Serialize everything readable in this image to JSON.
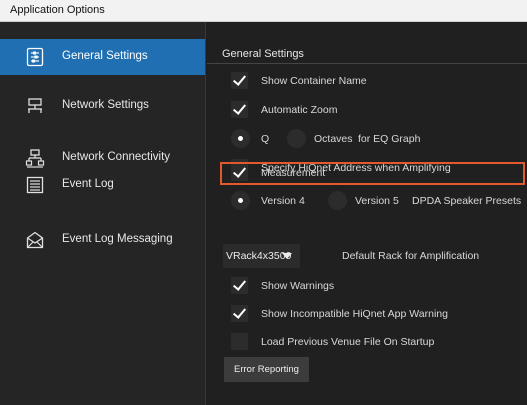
{
  "window": {
    "title": "Application Options"
  },
  "sidebar": {
    "items": [
      {
        "label": "General Settings",
        "icon": "settings-panel-icon",
        "active": true
      },
      {
        "label": "Network Settings",
        "icon": "network-icon",
        "active": false
      },
      {
        "label": "Network Connectivity",
        "icon": "network-tree-icon",
        "active": false
      },
      {
        "label": "Event Log",
        "icon": "list-icon",
        "active": false
      },
      {
        "label": "Event Log Messaging",
        "icon": "envelope-icon",
        "active": false
      }
    ]
  },
  "main": {
    "section_title": "General Settings",
    "show_container_name": {
      "label": "Show Container Name",
      "checked": true
    },
    "automatic_zoom": {
      "label": "Automatic Zoom",
      "checked": true
    },
    "eq_graph": {
      "option_q": "Q",
      "option_octaves": "Octaves",
      "suffix": "for EQ Graph",
      "selected": "Q"
    },
    "hiqnet_address": {
      "label": "Specify HiQnet Address when Amplifying",
      "checked": false
    },
    "measurement": {
      "label": "Measurement",
      "checked": true
    },
    "speaker_presets": {
      "option_v4": "Version 4",
      "option_v5": "Version 5",
      "suffix": "DPDA Speaker Presets",
      "selected": "Version 4"
    },
    "default_rack": {
      "value": "VRack4x3500",
      "label": "Default Rack for Amplification"
    },
    "show_warnings": {
      "label": "Show Warnings",
      "checked": true
    },
    "incompatible_warning": {
      "label": "Show Incompatible HiQnet App Warning",
      "checked": true
    },
    "load_previous_venue": {
      "label": "Load Previous Venue File On Startup",
      "checked": false
    },
    "error_reporting_button": "Error Reporting"
  },
  "colors": {
    "accent": "#1f6fb2",
    "highlight": "#e2592f",
    "background": "#1f1f1f"
  }
}
